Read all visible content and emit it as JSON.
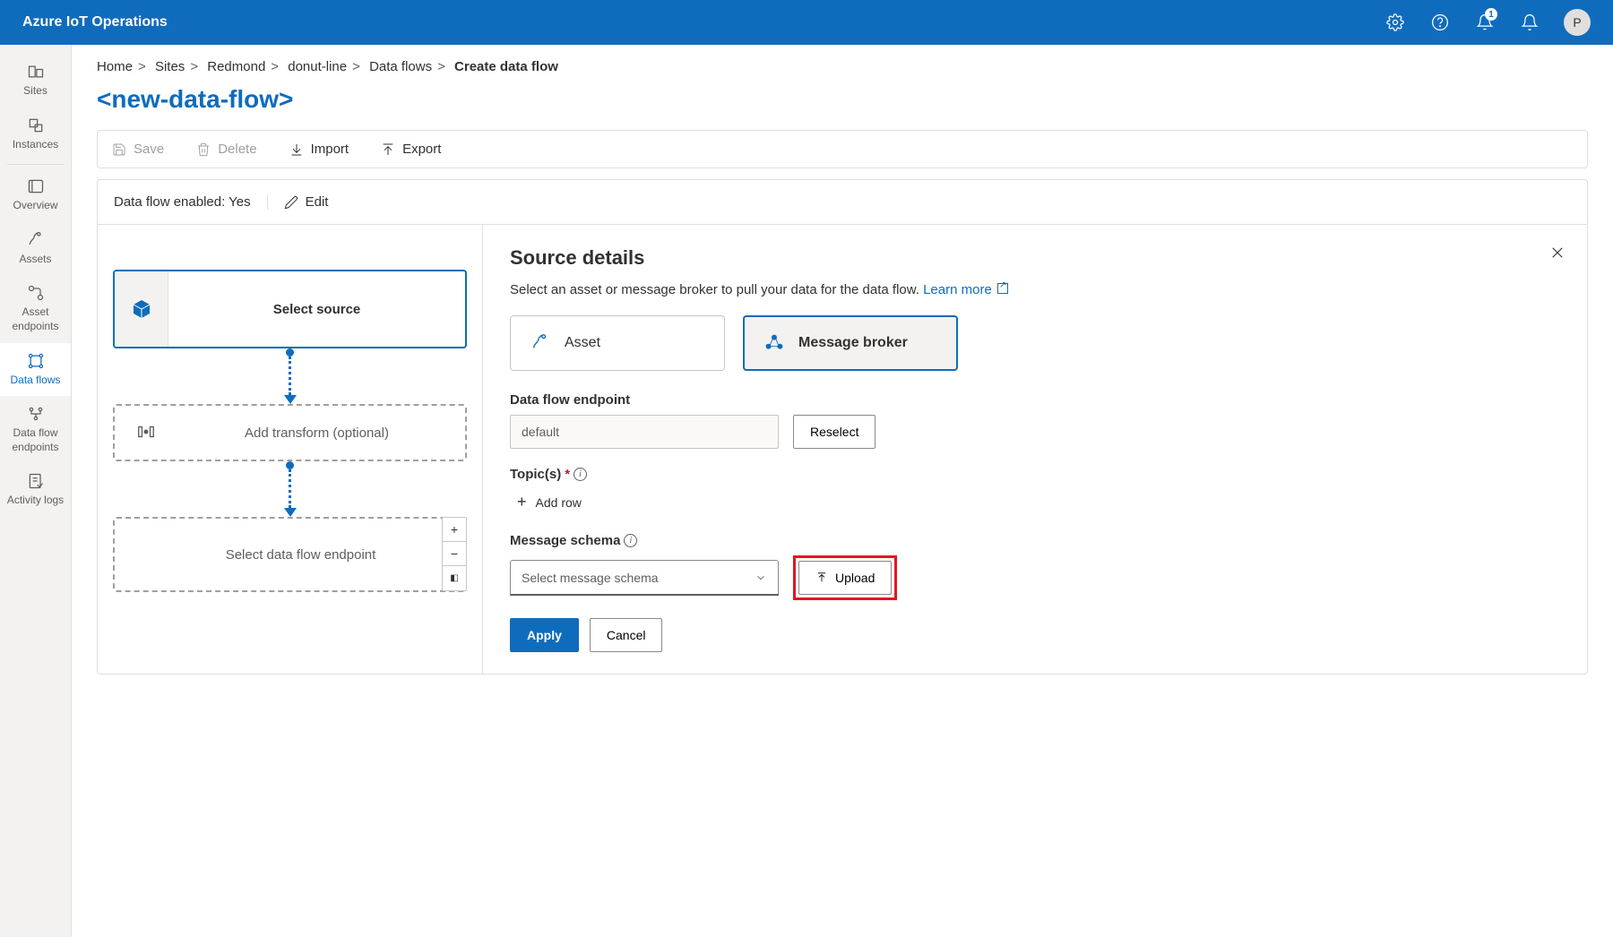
{
  "header": {
    "title": "Azure IoT Operations",
    "avatar": "P",
    "badge": "1"
  },
  "sidebar": {
    "items": [
      {
        "label": "Sites",
        "name": "sites"
      },
      {
        "label": "Instances",
        "name": "instances"
      },
      {
        "label": "Overview",
        "name": "overview"
      },
      {
        "label": "Assets",
        "name": "assets"
      },
      {
        "label": "Asset endpoints",
        "name": "asset-endpoints"
      },
      {
        "label": "Data flows",
        "name": "data-flows",
        "active": true
      },
      {
        "label": "Data flow endpoints",
        "name": "data-flow-endpoints"
      },
      {
        "label": "Activity logs",
        "name": "activity-logs"
      }
    ]
  },
  "breadcrumb": {
    "items": [
      "Home",
      "Sites",
      "Redmond",
      "donut-line",
      "Data flows"
    ],
    "current": "Create data flow",
    "sep": ">"
  },
  "pageTitle": "<new-data-flow>",
  "toolbar": {
    "save": "Save",
    "delete": "Delete",
    "import": "Import",
    "export": "Export"
  },
  "status": {
    "label": "Data flow enabled: Yes",
    "edit": "Edit"
  },
  "flow": {
    "source": "Select source",
    "transform": "Add transform (optional)",
    "endpoint": "Select data flow endpoint"
  },
  "details": {
    "title": "Source details",
    "desc": "Select an asset or message broker to pull your data for the data flow. ",
    "learnMore": "Learn more",
    "optionAsset": "Asset",
    "optionBroker": "Message broker",
    "endpointLabel": "Data flow endpoint",
    "endpointValue": "default",
    "reselect": "Reselect",
    "topicsLabel": "Topic(s)",
    "addRow": "Add row",
    "schemaLabel": "Message schema",
    "schemaPlaceholder": "Select message schema",
    "upload": "Upload",
    "apply": "Apply",
    "cancel": "Cancel"
  }
}
